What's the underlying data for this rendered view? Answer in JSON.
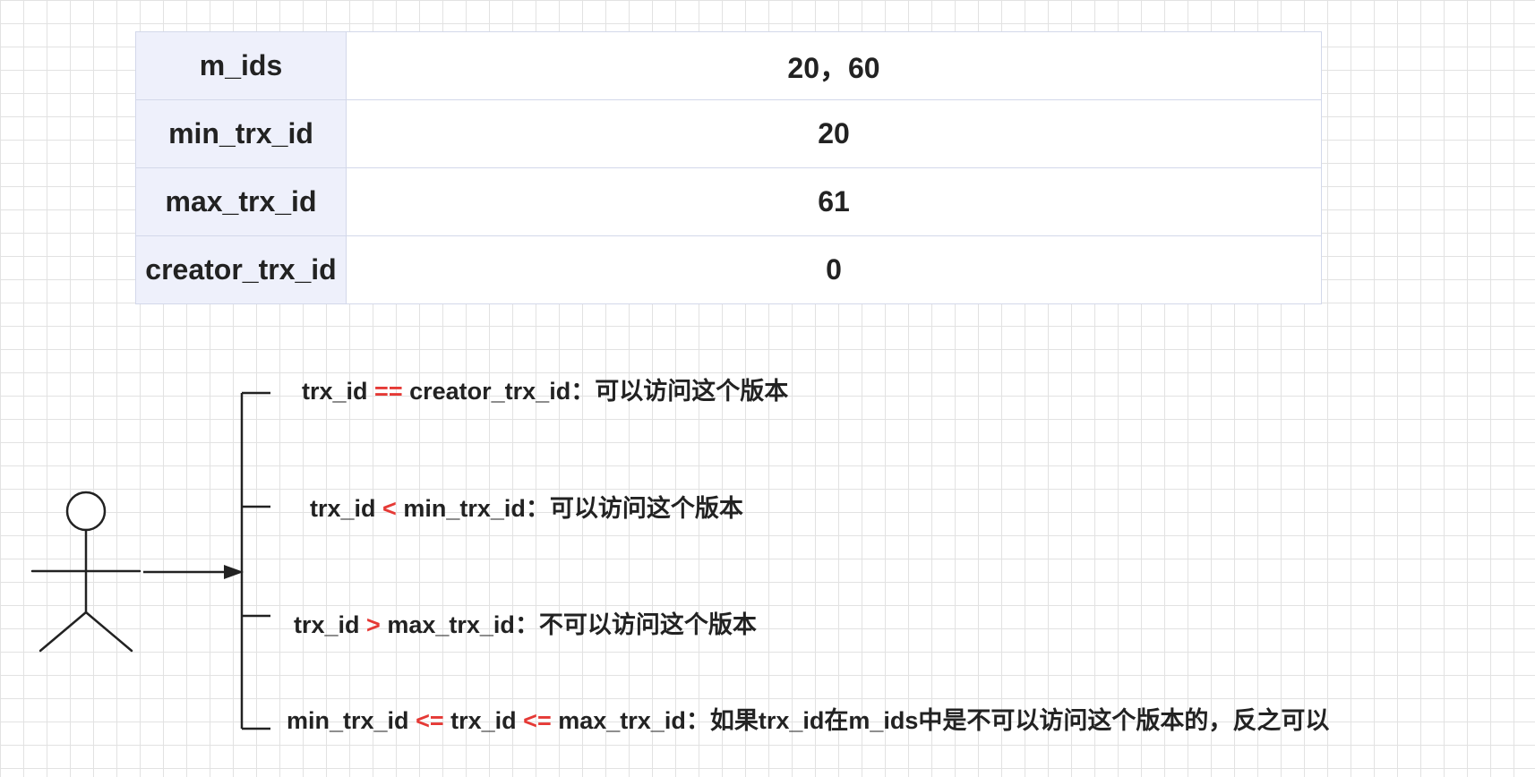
{
  "read_view": {
    "rows": [
      {
        "key": "m_ids",
        "value": "20，60"
      },
      {
        "key": "min_trx_id",
        "value": "20"
      },
      {
        "key": "max_trx_id",
        "value": "61"
      },
      {
        "key": "creator_trx_id",
        "value": "0"
      }
    ]
  },
  "rules": [
    {
      "left": "trx_id",
      "op1": "==",
      "middle": "creator_trx_id",
      "op2": "",
      "right": "",
      "result": "：可以访问这个版本"
    },
    {
      "left": "trx_id",
      "op1": "<",
      "middle": "min_trx_id",
      "op2": "",
      "right": "",
      "result": "：可以访问这个版本"
    },
    {
      "left": "trx_id",
      "op1": ">",
      "middle": "max_trx_id",
      "op2": "",
      "right": "",
      "result": "：不可以访问这个版本"
    },
    {
      "left": "min_trx_id",
      "op1": "<=",
      "middle": "trx_id",
      "op2": "<=",
      "right": "max_trx_id",
      "result": "：如果trx_id在m_ids中是不可以访问这个版本的，反之可以"
    }
  ],
  "colors": {
    "operator": "#e53935",
    "text": "#222222",
    "key_cell_bg": "#eef0fb",
    "cell_border": "#d3d8ea",
    "grid": "#e2e2e2"
  },
  "icons": {
    "actor": "stick-figure-icon",
    "arrow": "arrow-right-icon"
  }
}
